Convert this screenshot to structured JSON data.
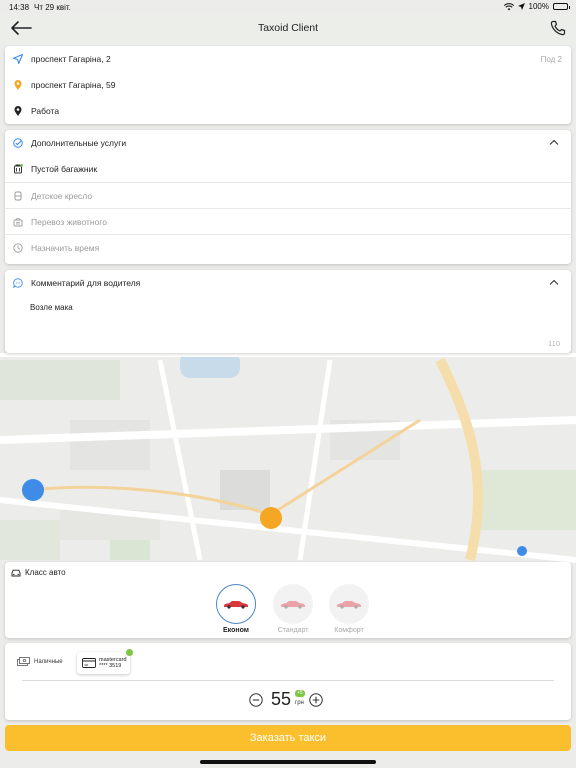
{
  "status_bar": {
    "time": "14:38",
    "date": "Чт 29 квіт.",
    "battery": "100%"
  },
  "header": {
    "title": "Taxoid Client",
    "back_icon": "arrow-left-icon",
    "phone_icon": "phone-icon"
  },
  "route": {
    "items": [
      {
        "icon": "navigation-arrow-icon",
        "color": "#3f8be8",
        "label": "проспект Гагаріна, 2",
        "meta": "Под 2"
      },
      {
        "icon": "pin-icon",
        "color": "#f5a623",
        "label": "проспект Гагаріна, 59"
      },
      {
        "icon": "pin-icon",
        "color": "#222222",
        "label": "Работа"
      }
    ]
  },
  "services": {
    "title": "Дополнительные услуги",
    "items": [
      {
        "icon": "luggage-icon",
        "label": "Пустой багажник",
        "active": true
      },
      {
        "icon": "child-seat-icon",
        "label": "Детское кресло",
        "active": false
      },
      {
        "icon": "pet-icon",
        "label": "Перевоз животного",
        "active": false
      },
      {
        "icon": "clock-icon",
        "label": "Назначить время",
        "active": false
      }
    ]
  },
  "comment": {
    "title": "Комментарий для водителя",
    "text": "Возле мака",
    "remaining": "110"
  },
  "car_class": {
    "title": "Класс авто",
    "options": [
      {
        "label": "Економ",
        "selected": true
      },
      {
        "label": "Стандарт",
        "selected": false
      },
      {
        "label": "Комфорт",
        "selected": false
      }
    ]
  },
  "payment": {
    "cash_label": "Наличные",
    "card_brand": "mastercard",
    "card_number": "**** 3519"
  },
  "price": {
    "value": "55",
    "currency": "грн",
    "badge": "+5"
  },
  "order_button": "Заказать такси",
  "colors": {
    "accent": "#fbbf2d",
    "blue": "#3f8be8",
    "orange": "#f5a623",
    "green": "#7cc644"
  }
}
